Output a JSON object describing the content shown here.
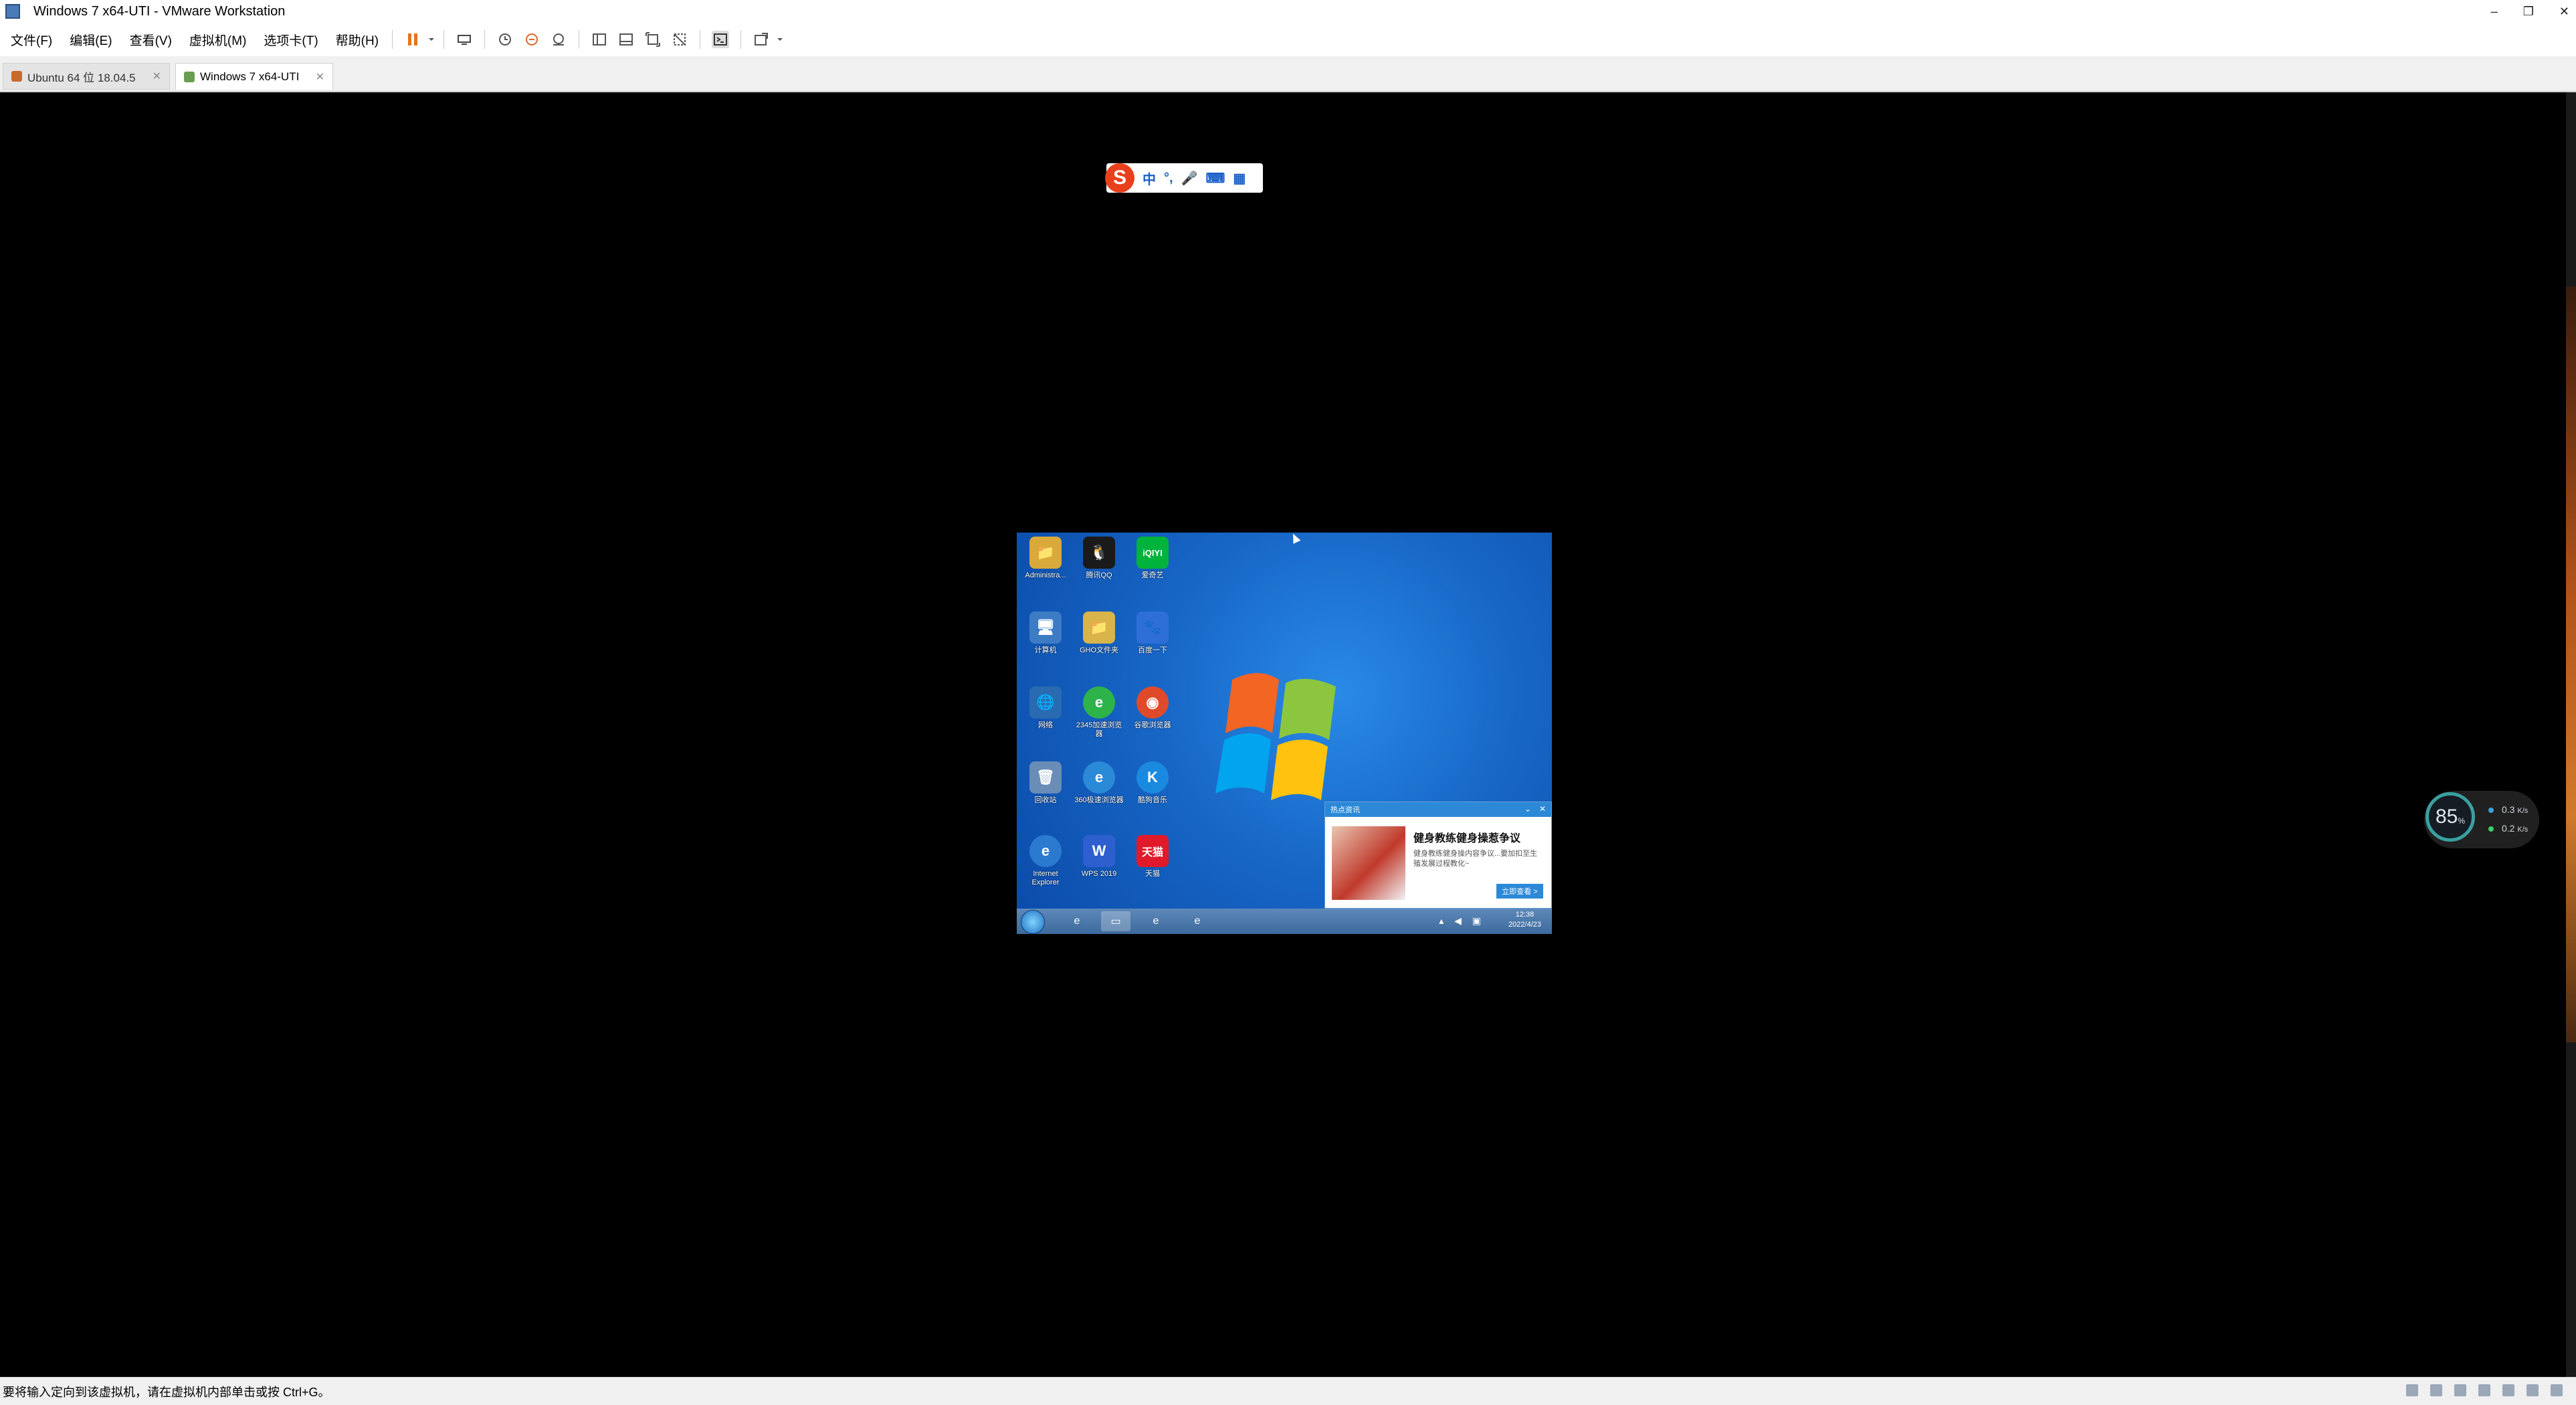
{
  "window": {
    "title": "Windows 7 x64-UTI - VMware Workstation",
    "controls": [
      "–",
      "❐",
      "✕"
    ]
  },
  "menu": [
    "文件(F)",
    "编辑(E)",
    "查看(V)",
    "虚拟机(M)",
    "选项卡(T)",
    "帮助(H)"
  ],
  "toolbar_icons": [
    "pause-icon",
    "dropdown-icon",
    "send-ctrl-alt-del-icon",
    "snapshot-icon",
    "revert-snapshot-icon",
    "snapshot-manager-icon",
    "library-view-icon",
    "thumbnail-view-icon",
    "full-screen-icon",
    "unity-icon",
    "console-view-icon",
    "stretch-guest-icon"
  ],
  "tabs": [
    {
      "label": "Ubuntu 64 位 18.04.5",
      "active": false
    },
    {
      "label": "Windows 7 x64-UTI",
      "active": true
    }
  ],
  "ime": {
    "logo": "S",
    "buttons": [
      "中",
      "°,",
      "🎤",
      "⌨",
      "▦"
    ]
  },
  "guest": {
    "icons": [
      {
        "label": "Administra...",
        "glyph": "📁",
        "color": "#d9a93a"
      },
      {
        "label": "腾讯QQ",
        "glyph": "🐧",
        "color": "#1a1a1a"
      },
      {
        "label": "爱奇艺",
        "glyph": "iQIYI",
        "color": "#00b33c"
      },
      {
        "label": "计算机",
        "glyph": "🖥",
        "color": "#3d7cc4"
      },
      {
        "label": "GHO文件夹",
        "glyph": "📁",
        "color": "#d8b44a"
      },
      {
        "label": "百度一下",
        "glyph": "🐾",
        "color": "#2d6fd6"
      },
      {
        "label": "网络",
        "glyph": "🌐",
        "color": "#2a6ab0"
      },
      {
        "label": "2345加速浏览器",
        "glyph": "e",
        "color": "#2db34a"
      },
      {
        "label": "谷歌浏览器",
        "glyph": "◉",
        "color": "#e04a2a"
      },
      {
        "label": "回收站",
        "glyph": "🗑",
        "color": "#6a8db8"
      },
      {
        "label": "360极速浏览器",
        "glyph": "e",
        "color": "#2a8ad8"
      },
      {
        "label": "酷狗音乐",
        "glyph": "K",
        "color": "#1a8ae0"
      },
      {
        "label": "Internet Explorer",
        "glyph": "e",
        "color": "#2a7ad0"
      },
      {
        "label": "WPS 2019",
        "glyph": "W",
        "color": "#2d5fcf"
      },
      {
        "label": "天猫",
        "glyph": "天猫",
        "color": "#e01a2a"
      }
    ],
    "popup": {
      "header": "热点资讯",
      "title": "健身教练健身操惹争议",
      "desc": "健身教练健身操内容争议...要加扣至生殖发展过程教化~",
      "button": "立即查看 >"
    },
    "clock": {
      "time": "12:38",
      "date": "2022/4/23"
    },
    "tray": "▴ ◀ ▣"
  },
  "net_widget": {
    "percent": "85",
    "percent_unit": "%",
    "up": "0.3",
    "up_unit": "K/s",
    "down": "0.2",
    "down_unit": "K/s"
  },
  "status": {
    "text": "要将输入定向到该虚拟机，请在虚拟机内部单击或按 Ctrl+G。"
  }
}
